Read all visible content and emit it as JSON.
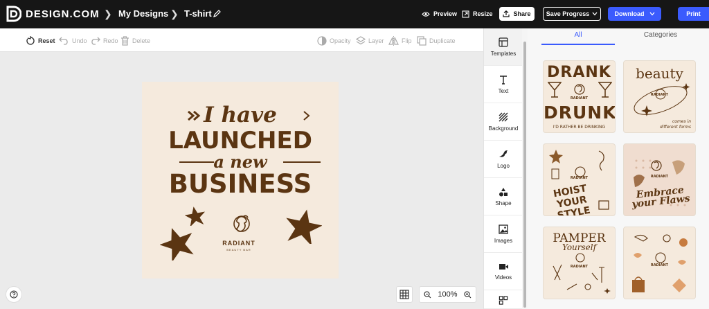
{
  "brand": {
    "logo_text": "DESIGN.COM"
  },
  "breadcrumb": {
    "my_designs": "My Designs",
    "current": "T-shirt"
  },
  "header": {
    "preview": "Preview",
    "resize": "Resize",
    "share": "Share",
    "save_progress": "Save Progress",
    "download": "Download",
    "print": "Print"
  },
  "toolbar": {
    "reset": "Reset",
    "undo": "Undo",
    "redo": "Redo",
    "delete": "Delete",
    "opacity": "Opacity",
    "layer": "Layer",
    "flip": "Flip",
    "duplicate": "Duplicate"
  },
  "design": {
    "line1": "I have",
    "line2": "LAUNCHED",
    "line3": "a new",
    "line4": "BUSINESS",
    "brand_name": "RADIANT",
    "brand_sub": "BEAUTY BAR",
    "colors": {
      "background": "#f5eadd",
      "ink": "#5b3512"
    }
  },
  "zoom": {
    "level": "100%"
  },
  "side_tools": [
    {
      "label": "Templates",
      "icon": "templates-icon"
    },
    {
      "label": "Text",
      "icon": "text-icon"
    },
    {
      "label": "Background",
      "icon": "background-icon"
    },
    {
      "label": "Logo",
      "icon": "logo-icon"
    },
    {
      "label": "Shape",
      "icon": "shape-icon"
    },
    {
      "label": "Images",
      "icon": "images-icon"
    },
    {
      "label": "Videos",
      "icon": "videos-icon"
    }
  ],
  "template_tabs": {
    "all": "All",
    "categories": "Categories"
  },
  "templates": [
    {
      "top": "DRANK",
      "mid": "RADIANT",
      "bottom": "DRUNK",
      "caption": "I'D RATHER BE DRINKING"
    },
    {
      "top": "beauty",
      "mid": "RADIANT",
      "caption": "comes in different forms"
    },
    {
      "mid": "RADIANT",
      "bottom": "HOIST YOUR STYLE"
    },
    {
      "mid": "RADIANT",
      "bottom": "Embrace your Flaws"
    },
    {
      "top": "PAMPER",
      "sub": "Yourself",
      "mid": "RADIANT"
    },
    {
      "mid": "RADIANT"
    }
  ],
  "accent_color": "#3b5bfd"
}
